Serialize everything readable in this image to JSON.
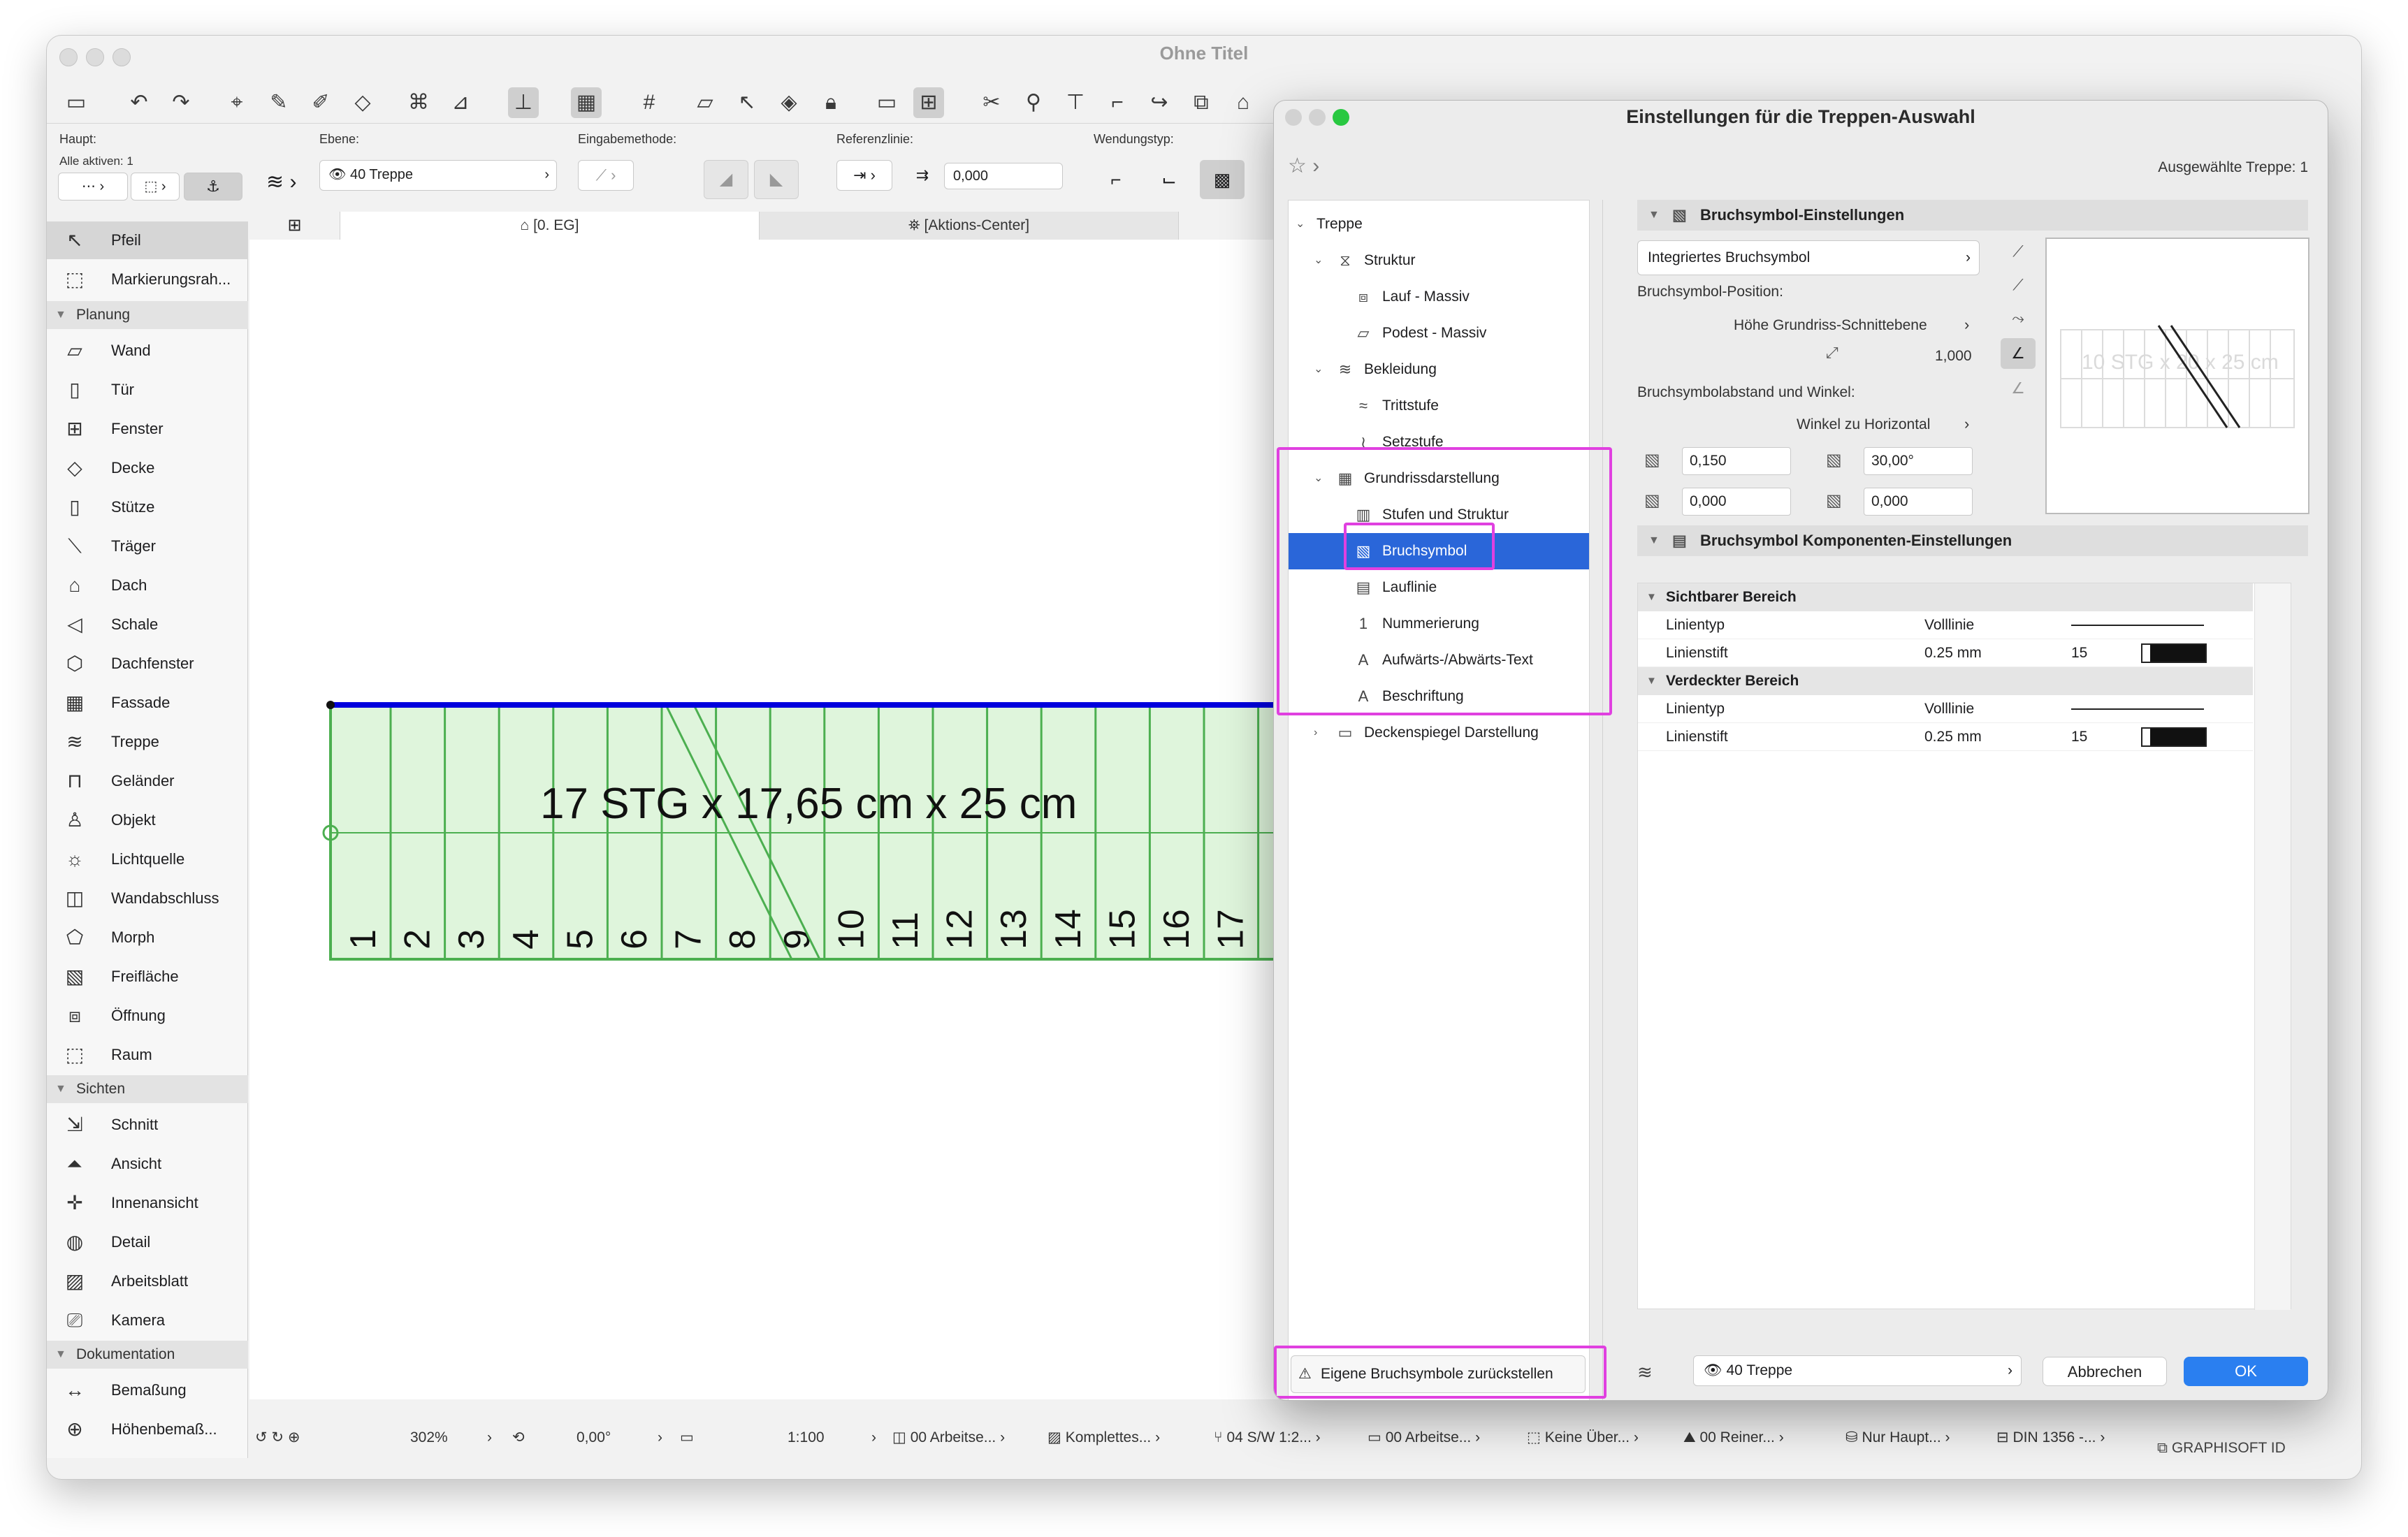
{
  "window": {
    "title": "Ohne Titel"
  },
  "infobox": {
    "haupt_label": "Haupt:",
    "alle_aktiven": "Alle aktiven: 1",
    "ebene_label": "Ebene:",
    "ebene_value": "40 Treppe",
    "eingabemethode_label": "Eingabemethode:",
    "referenzlinie_label": "Referenzlinie:",
    "referenz_value": "0,000",
    "wendungstyp_label": "Wendungstyp:"
  },
  "tabs": [
    {
      "label": "[0. EG]"
    },
    {
      "label": "[Aktions-Center]"
    }
  ],
  "toolbox": {
    "items_top": [
      {
        "label": "Pfeil",
        "icon": "arrow-icon"
      },
      {
        "label": "Markierungsrah...",
        "icon": "marquee-icon"
      }
    ],
    "sections": [
      {
        "title": "Planung",
        "items": [
          "Wand",
          "Tür",
          "Fenster",
          "Decke",
          "Stütze",
          "Träger",
          "Dach",
          "Schale",
          "Dachfenster",
          "Fassade",
          "Treppe",
          "Geländer",
          "Objekt",
          "Lichtquelle",
          "Wandabschluss",
          "Morph",
          "Freifläche",
          "Öffnung",
          "Raum"
        ]
      },
      {
        "title": "Sichten",
        "items": [
          "Schnitt",
          "Ansicht",
          "Innenansicht",
          "Detail",
          "Arbeitsblatt",
          "Kamera"
        ]
      },
      {
        "title": "Dokumentation",
        "items": [
          "Bemaßung",
          "Höhenbemaß..."
        ]
      }
    ]
  },
  "canvas": {
    "stair_label": "17 STG x 17,65 cm x 25 cm",
    "step_numbers": [
      "1",
      "2",
      "3",
      "4",
      "5",
      "6",
      "7",
      "8",
      "9",
      "10",
      "11",
      "12",
      "13",
      "14",
      "15",
      "16",
      "17"
    ]
  },
  "statusbar": {
    "zoom": "302%",
    "angle": "0,00°",
    "scale": "1:100",
    "items": [
      "00 Arbeitse...",
      "Komplettes...",
      "04 S/W 1:2...",
      "00 Arbeitse...",
      "Keine Über...",
      "00 Reiner...",
      "Nur Haupt...",
      "DIN 1356 -..."
    ],
    "graphisoft": "GRAPHISOFT ID"
  },
  "dialog": {
    "title": "Einstellungen für die Treppen-Auswahl",
    "selected_count": "Ausgewählte Treppe: 1",
    "tree": [
      {
        "label": "Treppe",
        "level": 0,
        "chev": "v",
        "icon": ""
      },
      {
        "label": "Struktur",
        "level": 1,
        "chev": "v",
        "icon": "stair-structure-icon"
      },
      {
        "label": "Lauf - Massiv",
        "level": 2,
        "chev": "",
        "icon": "flight-icon"
      },
      {
        "label": "Podest - Massiv",
        "level": 2,
        "chev": "",
        "icon": "landing-icon"
      },
      {
        "label": "Bekleidung",
        "level": 1,
        "chev": "v",
        "icon": "finish-icon"
      },
      {
        "label": "Trittstufe",
        "level": 2,
        "chev": "",
        "icon": "tread-icon"
      },
      {
        "label": "Setzstufe",
        "level": 2,
        "chev": "",
        "icon": "riser-icon"
      },
      {
        "label": "Grundrissdarstellung",
        "level": 1,
        "chev": "v",
        "icon": "floorplan-icon"
      },
      {
        "label": "Stufen und Struktur",
        "level": 2,
        "chev": "",
        "icon": "steps-icon"
      },
      {
        "label": "Bruchsymbol",
        "level": 2,
        "chev": "",
        "icon": "break-mark-icon",
        "selected": true
      },
      {
        "label": "Lauflinie",
        "level": 2,
        "chev": "",
        "icon": "walkline-icon"
      },
      {
        "label": "Nummerierung",
        "level": 2,
        "chev": "",
        "icon": "numbering-icon"
      },
      {
        "label": "Aufwärts-/Abwärts-Text",
        "level": 2,
        "chev": "",
        "icon": "text-icon"
      },
      {
        "label": "Beschriftung",
        "level": 2,
        "chev": "",
        "icon": "label-icon"
      },
      {
        "label": "Deckenspiegel Darstellung",
        "level": 1,
        "chev": ">",
        "icon": "ceiling-icon"
      }
    ],
    "reset_button": "Eigene Bruchsymbole zurückstellen",
    "break_settings": {
      "title": "Bruchsymbol-Einstellungen",
      "type_value": "Integriertes Bruchsymbol",
      "position_label": "Bruchsymbol-Position:",
      "position_value": "Höhe Grundriss-Schnittebene",
      "height_value": "1,000",
      "distance_label": "Bruchsymbolabstand und Winkel:",
      "angle_mode": "Winkel zu Horizontal",
      "dist1": "0,150",
      "angle1": "30,00°",
      "dist2": "0,000",
      "angle2": "0,000",
      "preview_text": "10 STG x 20 x 25 cm"
    },
    "components": {
      "title": "Bruchsymbol Komponenten-Einstellungen",
      "groups": [
        {
          "title": "Sichtbarer Bereich",
          "rows": [
            {
              "label": "Linientyp",
              "value": "Volllinie",
              "pen": ""
            },
            {
              "label": "Linienstift",
              "value": "0.25 mm",
              "pen": "15"
            }
          ]
        },
        {
          "title": "Verdeckter Bereich",
          "rows": [
            {
              "label": "Linientyp",
              "value": "Volllinie",
              "pen": ""
            },
            {
              "label": "Linienstift",
              "value": "0.25 mm",
              "pen": "15"
            }
          ]
        }
      ]
    },
    "footer": {
      "layer_value": "40 Treppe",
      "cancel": "Abbrechen",
      "ok": "OK"
    }
  },
  "colors": {
    "selection_blue": "#2a66d9",
    "highlight_magenta": "#e040e0",
    "stair_green": "#4caf50",
    "stair_fill": "#dff5dc",
    "edge_blue": "#0000dd",
    "ok_blue": "#2a7ff0"
  }
}
